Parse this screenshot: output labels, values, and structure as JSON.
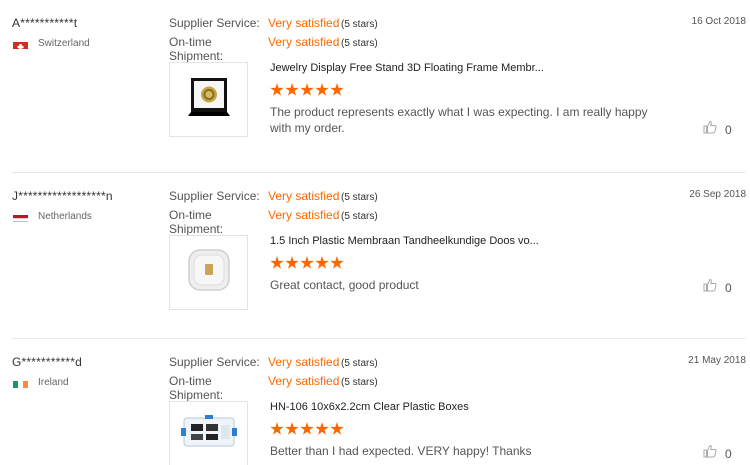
{
  "labels": {
    "supplier_service": "Supplier Service:",
    "ontime_shipment": "On-time Shipment:"
  },
  "accent_color": "#ff6600",
  "reviews": [
    {
      "buyer": "A***********t",
      "country": "Switzerland",
      "flag": "switzerland-flag",
      "date": "16 Oct 2018",
      "supplier_rating": "Very satisfied",
      "supplier_stars": "(5 stars)",
      "shipment_rating": "Very satisfied",
      "shipment_stars": "(5 stars)",
      "product_title": "Jewelry Display Free Stand 3D Floating Frame Membr...",
      "product_icon": "floating-frame-display-image",
      "star_count": 5,
      "text": "The product represents exactly what I was expecting. I am really happy with my order.",
      "likes": "0"
    },
    {
      "buyer": "J******************n",
      "country": "Netherlands",
      "flag": "netherlands-flag",
      "date": "26 Sep 2018",
      "supplier_rating": "Very satisfied",
      "supplier_stars": "(5 stars)",
      "shipment_rating": "Very satisfied",
      "shipment_stars": "(5 stars)",
      "product_title": "1.5 Inch Plastic Membraan Tandheelkundige Doos vo...",
      "product_icon": "membrane-box-image",
      "star_count": 5,
      "text": "Great contact, good product",
      "likes": "0"
    },
    {
      "buyer": "G***********d",
      "country": "Ireland",
      "flag": "ireland-flag",
      "date": "21 May 2018",
      "supplier_rating": "Very satisfied",
      "supplier_stars": "(5 stars)",
      "shipment_rating": "Very satisfied",
      "shipment_stars": "(5 stars)",
      "product_title": "HN-106 10x6x2.2cm Clear Plastic Boxes",
      "product_icon": "clear-plastic-box-image",
      "star_count": 5,
      "text": "Better than I had expected. VERY happy! Thanks",
      "likes": "0"
    }
  ]
}
